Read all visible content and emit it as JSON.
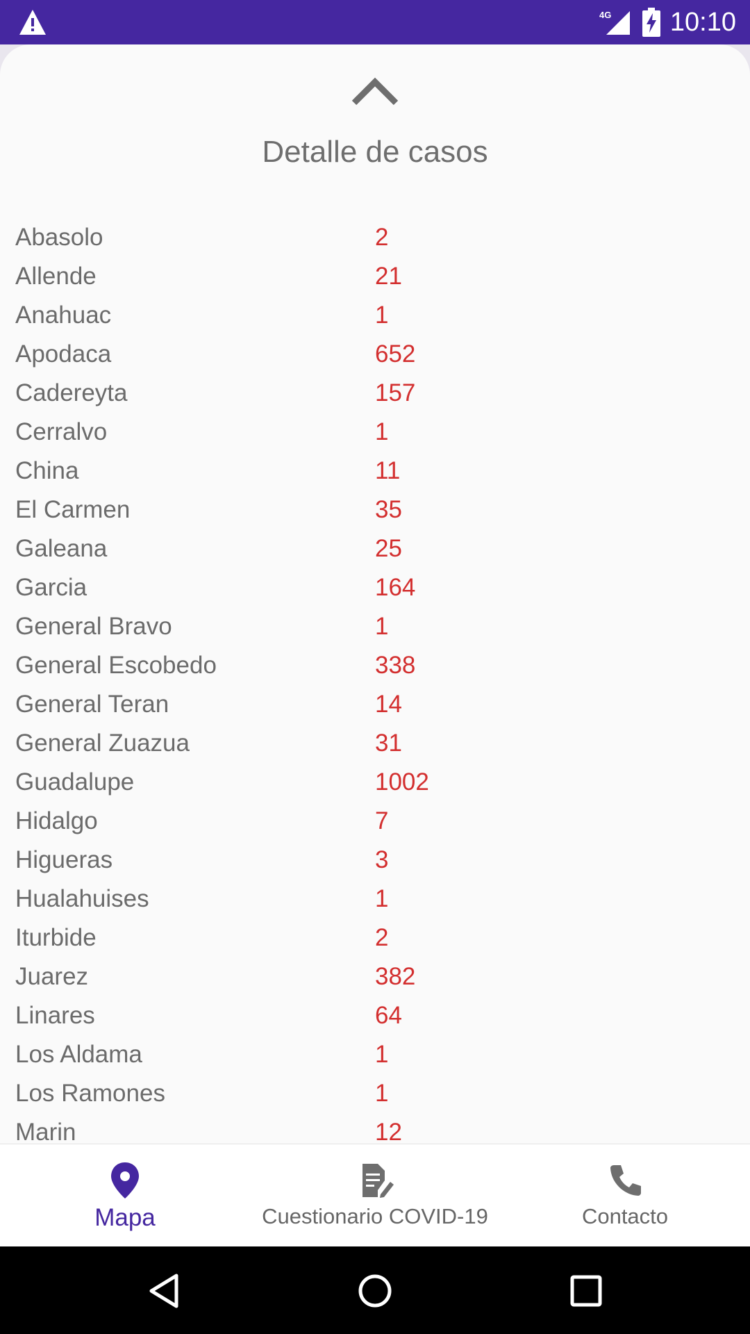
{
  "status_bar": {
    "time": "10:10",
    "network": "4G",
    "icons": [
      "warning-icon",
      "signal-icon",
      "battery-charging-icon"
    ]
  },
  "sheet": {
    "title": "Detalle de casos",
    "handle_icon": "chevron-up-icon",
    "rows": [
      {
        "name": "Abasolo",
        "count": "2"
      },
      {
        "name": "Allende",
        "count": "21"
      },
      {
        "name": "Anahuac",
        "count": "1"
      },
      {
        "name": "Apodaca",
        "count": "652"
      },
      {
        "name": "Cadereyta",
        "count": "157"
      },
      {
        "name": "Cerralvo",
        "count": "1"
      },
      {
        "name": "China",
        "count": "11"
      },
      {
        "name": "El Carmen",
        "count": "35"
      },
      {
        "name": "Galeana",
        "count": "25"
      },
      {
        "name": "Garcia",
        "count": "164"
      },
      {
        "name": "General Bravo",
        "count": "1"
      },
      {
        "name": "General Escobedo",
        "count": "338"
      },
      {
        "name": "General Teran",
        "count": "14"
      },
      {
        "name": "General Zuazua",
        "count": "31"
      },
      {
        "name": "Guadalupe",
        "count": "1002"
      },
      {
        "name": "Hidalgo",
        "count": "7"
      },
      {
        "name": "Higueras",
        "count": "3"
      },
      {
        "name": "Hualahuises",
        "count": "1"
      },
      {
        "name": "Iturbide",
        "count": "2"
      },
      {
        "name": "Juarez",
        "count": "382"
      },
      {
        "name": "Linares",
        "count": "64"
      },
      {
        "name": "Los Aldama",
        "count": "1"
      },
      {
        "name": "Los Ramones",
        "count": "1"
      },
      {
        "name": "Marin",
        "count": "12"
      }
    ]
  },
  "bottom_nav": {
    "items": [
      {
        "label": "Mapa",
        "icon": "map-pin-icon",
        "active": true
      },
      {
        "label": "Cuestionario COVID-19",
        "icon": "form-edit-icon",
        "active": false
      },
      {
        "label": "Contacto",
        "icon": "phone-icon",
        "active": false
      }
    ]
  },
  "colors": {
    "accent": "#4527a0",
    "count_text": "#d32f2f",
    "label_text": "#6b6b6b"
  }
}
